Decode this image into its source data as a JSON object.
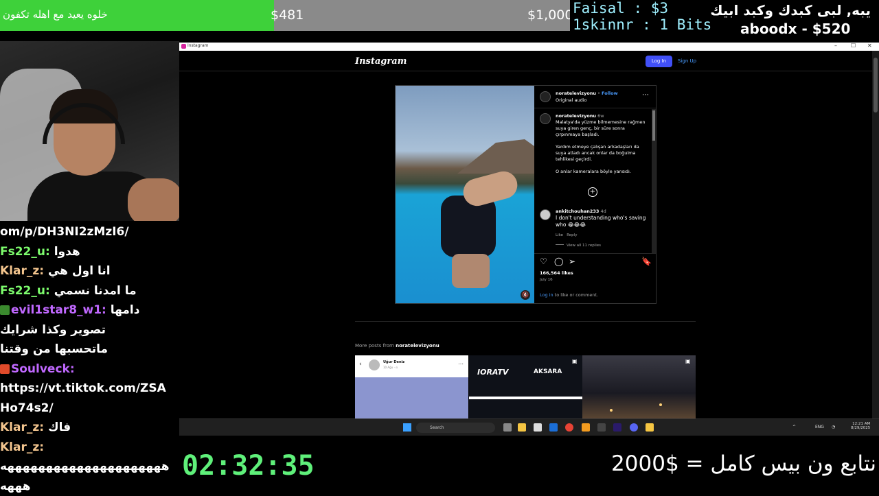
{
  "stream_overlay": {
    "goal_title": "خلوه يعيد مع اهله تكفون",
    "goal_current": "$481",
    "goal_target": "$1,000",
    "goal_progress_fraction": 0.481,
    "top_donor_1": "Faisal : $3",
    "top_donor_2": "1skinnr : 1 Bits",
    "top_right_1": "يبه, لبى كبدك وكبد ابيك",
    "top_right_2": "aboodx - $520",
    "timer": "02:32:35",
    "bottom_goal": "نتابع ون بيس كامل = $2000",
    "colors": {
      "goal_fill": "#3ed13a",
      "timer": "#5ff07a"
    }
  },
  "chat": {
    "lines": [
      {
        "user": "",
        "text": "om/p/DH3NI2zMzI6/"
      },
      {
        "user": "Fs22_u:",
        "text": " هدوا"
      },
      {
        "user": "Klar_z:",
        "text": " انا اول هي"
      },
      {
        "user": "Fs22_u:",
        "text": " ما امدنا نسمي"
      },
      {
        "user": "evil1star8_w1:",
        "text": " دامها"
      },
      {
        "user": "",
        "text": "تصوير وكذا شرايك"
      },
      {
        "user": "",
        "text": "ماتحسبها من وقتنا"
      },
      {
        "user": "Soulveck:",
        "text": ""
      },
      {
        "user": "",
        "text": "https://vt.tiktok.com/ZSA"
      },
      {
        "user": "",
        "text": "Ho74s2/"
      },
      {
        "user": "Klar_z:",
        "text": " فاك"
      },
      {
        "user": "Klar_z:",
        "text": ""
      },
      {
        "user": "",
        "text": "هههههههههههههههههههههه"
      },
      {
        "user": "",
        "text": "هههه"
      }
    ]
  },
  "window": {
    "title": "Instagram",
    "controls": [
      "–",
      "☐",
      "✕"
    ]
  },
  "instagram": {
    "logo": "Instagram",
    "login_label": "Log In",
    "signup_label": "Sign Up",
    "post": {
      "username": "noratelevizyonu",
      "follow_label": "Follow",
      "separator": " • ",
      "audio": "Original audio",
      "caption_user": "noratelevizyonu",
      "caption_age": "6w",
      "caption_p1": "Malatya'da yüzme bilmemesine rağmen suya giren genç, bir süre sonra çırpınmaya başladı.",
      "caption_p2": "Yardım etmeye çalışan arkadaşları da suya atladı ancak onlar da boğulma tehlikesi geçirdi.",
      "caption_p3": "O anlar kameralara böyle yansıdı.",
      "comment_user": "ankitchouhan233",
      "comment_age": "4d",
      "comment_text": "I don't understanding who's saving who 😂😂😂",
      "like_label": "Like",
      "reply_label": "Reply",
      "view_replies": "View all 11 replies",
      "likes": "166,564 likes",
      "date": "July 16",
      "login_prompt_link": "Log in",
      "login_prompt_rest": " to like or comment."
    },
    "more_posts_prefix": "More posts from ",
    "more_posts_user": "noratelevizyonu",
    "thumb1_name": "Uğur Deniz",
    "thumb1_sub": "10 Ağu · ⊙",
    "thumb2_brand": "IORATV",
    "thumb2_place": "AKSARA"
  },
  "taskbar": {
    "search_placeholder": "Search",
    "lang": "ENG",
    "time": "12:21 AM",
    "date": "8/29/2025"
  }
}
